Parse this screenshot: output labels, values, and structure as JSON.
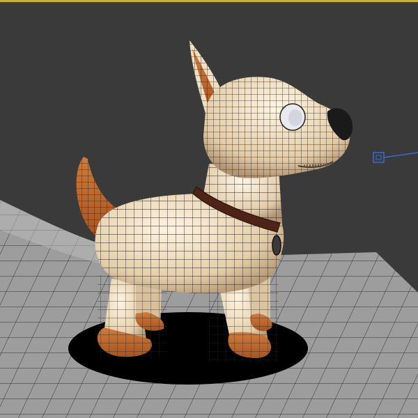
{
  "viewport": {
    "background": "#3a3a3a",
    "active_border_color": "#c8b13a"
  },
  "scene": {
    "subject": "dog-mesh",
    "surface_color": "#efe1c8",
    "accent_color": "#c8672a",
    "floor_color": "#9a9a9a",
    "wire_color": "#1c1c1c",
    "collar_color": "#5a2a1a",
    "shadow_color": "#000000"
  },
  "gizmo": {
    "icon": "light-target-icon",
    "color": "#3a6ad6"
  }
}
